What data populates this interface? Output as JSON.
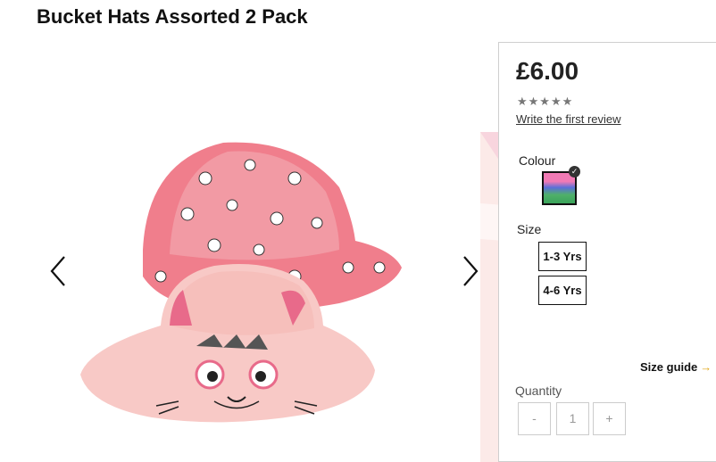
{
  "product": {
    "title": "Bucket Hats Assorted 2 Pack",
    "price": "£6.00",
    "rating_stars": "★★★★★",
    "review_link": "Write the first review"
  },
  "colour": {
    "label": "Colour",
    "selected_check": "✓"
  },
  "size": {
    "label": "Size",
    "options": [
      "1-3 Yrs",
      "4-6 Yrs"
    ]
  },
  "size_guide": {
    "label": "Size guide",
    "chevron": "→"
  },
  "quantity": {
    "label": "Quantity",
    "minus": "-",
    "value": "1",
    "plus": "+"
  },
  "icons": {
    "prev": "chevron-left-icon",
    "next": "chevron-right-icon"
  },
  "colors": {
    "hat_pink": "#f07e8c",
    "hat_light": "#f8c9c6",
    "accent": "#e2a516"
  }
}
